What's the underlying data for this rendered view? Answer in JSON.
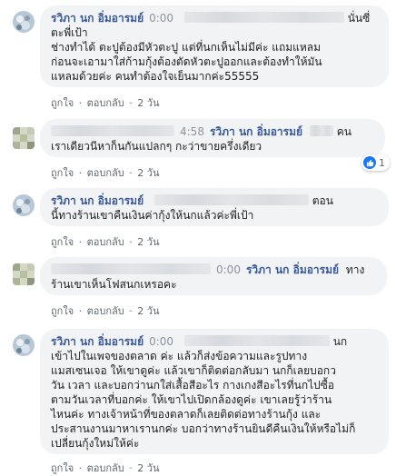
{
  "actions": {
    "like": "ถูกใจ",
    "reply": "ตอบกลับ",
    "separator": "·"
  },
  "colors": {
    "author": "#385898",
    "bubble": "#f2f3f5",
    "like": "#1877f2"
  },
  "comments": [
    {
      "author": "รวิภา นก อิ่มอารมย์",
      "timestamp": "0:00",
      "text_tail": "นั่นซี่",
      "lines": [
        "ตะพี่เป้า",
        "ช่างทำได้ ตะปูต้องมีหัวตะปู แต่ที่นกเห็นไม่มีค่ะ แถมแหลม",
        "ก่อนจะเอามาใส่ก้ามกุ้งต้องตัดหัวตะปูออกและต้องทำให้มัน",
        "แหลมด้วยค่ะ คนทำต้องใจเย็นมากค่ะ55555"
      ],
      "age": "2 วัน",
      "avatar_icon": "flower-avatar-icon"
    },
    {
      "author": "รวิภา นก อิ่มอารมย์",
      "timestamp": "4:58",
      "text_tail": "คน",
      "lines": [
        "เราเดียวนีหาก็นกันแปลกๆ กะว่าขายครึ่งเดียว"
      ],
      "age": "2 วัน",
      "reactions": "1",
      "avatar_icon": "pixel-avatar-icon"
    },
    {
      "author": "รวิภา นก อิ่มอารมย์",
      "text_tail": "ตอน",
      "lines": [
        "นี้ทางร้านเขาคืนเงินค่ากุ้งให้นกแล้วค่ะพี่เป้า"
      ],
      "age": "2 วัน",
      "avatar_icon": "flower-avatar-icon"
    },
    {
      "author": "รวิภา นก อิ่มอารมย์",
      "timestamp": "0:00",
      "text_tail": "ทาง",
      "lines": [
        "ร้านเขาเห็นโฟสนกเหรอคะ"
      ],
      "age": "2 วัน",
      "avatar_icon": "pixel-avatar-icon"
    },
    {
      "author": "รวิภา นก อิ่มอารมย์",
      "timestamp": "0:00",
      "text_tail": "นก",
      "lines": [
        "เข้าไปในเพจของตลาด  ค่ะ แล้วก็ส่งข้อความและรูปทาง",
        "แมสเซนเจอ ให้เขาดูค่ะ แล้วเขาก็ติดต่อกลับมา นกก็เลยบอกว",
        "วัน เวลา และบอกว่านกใส่เสื้อสีอะไร กางเกงสีอะไรที่นกไปซื้อ",
        "ตามวันเวลาที่บอกค่ะ ให้เขาไปเปิดกล้องดูค่ะ เขาเลยรู้ว่าร้าน",
        "ไหนค่ะ ทางเจ้าหน้าที่ของตลาดก็เลยติดต่อทางร้านกุ้ง และ",
        "ประสานงานมาหาเรานกค่ะ บอกว่าทางร้านยินดีคืนเงินให้หรือไม่ก็",
        "เปลี่ยนกุ้งใหม่ให้ค่ะ"
      ],
      "age": "2 วัน",
      "avatar_icon": "flower-avatar-icon"
    }
  ]
}
